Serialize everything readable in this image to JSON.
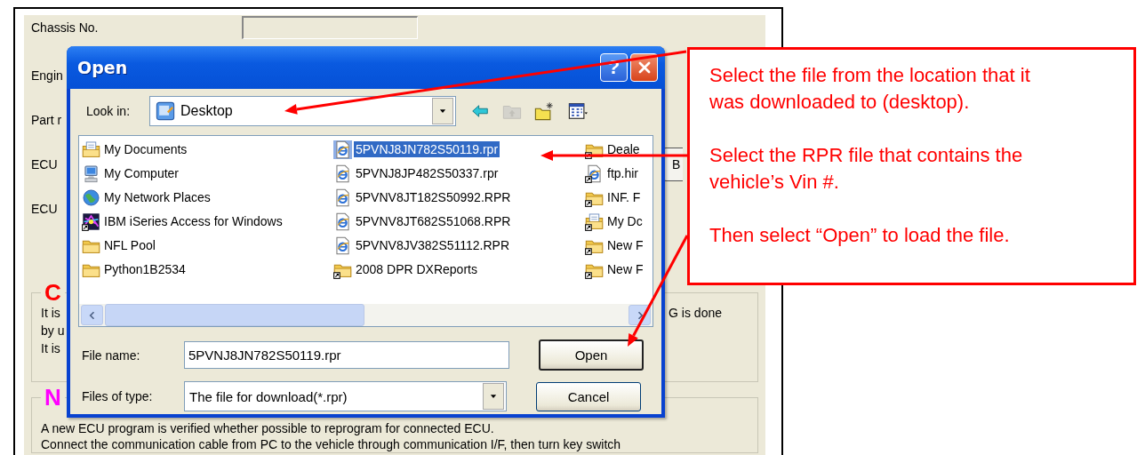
{
  "app": {
    "rows": [
      {
        "label": "Chassis No.",
        "has_field": true
      },
      {
        "label": "Engin",
        "has_field": false
      },
      {
        "label": "Part r",
        "has_field": false
      },
      {
        "label": "ECU",
        "has_field": false,
        "button": "B"
      },
      {
        "label": "ECU",
        "has_field": false
      }
    ],
    "groups": [
      {
        "title": "C",
        "color": "#ff0000",
        "lines": [
          {
            "left": "It is",
            "right": "G is done"
          },
          {
            "left": "by u"
          },
          {
            "left": "It is"
          }
        ]
      },
      {
        "title": "N",
        "color": "#ff00ff",
        "lines": [
          {
            "left": "A new ECU program is verified whether possible to reprogram for connected ECU."
          },
          {
            "left": "Connect the communication cable from PC to the vehicle through communication I/F, then turn key switch"
          }
        ]
      }
    ]
  },
  "dialog": {
    "title": "Open",
    "help": "?",
    "look_in": {
      "label": "Look in:",
      "value": "Desktop"
    },
    "toolbar": [
      {
        "kind": "back",
        "disabled": false
      },
      {
        "kind": "up",
        "disabled": true
      },
      {
        "kind": "new-folder",
        "disabled": false
      },
      {
        "kind": "views",
        "disabled": false
      }
    ],
    "files": [
      {
        "name": "My Documents",
        "kind": "documents",
        "selected": false
      },
      {
        "name": "My Computer",
        "kind": "computer",
        "selected": false
      },
      {
        "name": "My Network Places",
        "kind": "network",
        "selected": false
      },
      {
        "name": "IBM iSeries Access for Windows",
        "kind": "app",
        "selected": false
      },
      {
        "name": "NFL Pool",
        "kind": "folder",
        "selected": false
      },
      {
        "name": "Python1B2534",
        "kind": "folder",
        "selected": false
      },
      {
        "name": "5PVNJ8JN782S50119.rpr",
        "kind": "web",
        "selected": true
      },
      {
        "name": "5PVNJ8JP482S50337.rpr",
        "kind": "web",
        "selected": false
      },
      {
        "name": "5PVNV8JT182S50992.RPR",
        "kind": "web",
        "selected": false
      },
      {
        "name": "5PVNV8JT682S51068.RPR",
        "kind": "web",
        "selected": false
      },
      {
        "name": "5PVNV8JV382S51112.RPR",
        "kind": "web",
        "selected": false
      },
      {
        "name": "2008 DPR DXReports",
        "kind": "folder-link",
        "selected": false
      },
      {
        "name": "Deale",
        "kind": "folder-link",
        "selected": false
      },
      {
        "name": "ftp.hir",
        "kind": "web-link",
        "selected": false
      },
      {
        "name": "INF. F",
        "kind": "folder-link",
        "selected": false
      },
      {
        "name": "My Dc",
        "kind": "documents-link",
        "selected": false
      },
      {
        "name": "New F",
        "kind": "folder-link",
        "selected": false
      },
      {
        "name": "New F",
        "kind": "folder-link",
        "selected": false
      }
    ],
    "file_name": {
      "label": "File name:",
      "value": "5PVNJ8JN782S50119.rpr"
    },
    "file_type": {
      "label": "Files of type:",
      "value": "The file for download(*.rpr)"
    },
    "buttons": [
      {
        "label": "Open",
        "default": true
      },
      {
        "label": "Cancel",
        "default": false
      }
    ]
  },
  "callout": {
    "paragraphs": [
      "Select the file from the location that it was downloaded to (desktop).",
      "Select the RPR file that contains the vehicle’s Vin #.",
      "Then select “Open” to load the file."
    ]
  }
}
